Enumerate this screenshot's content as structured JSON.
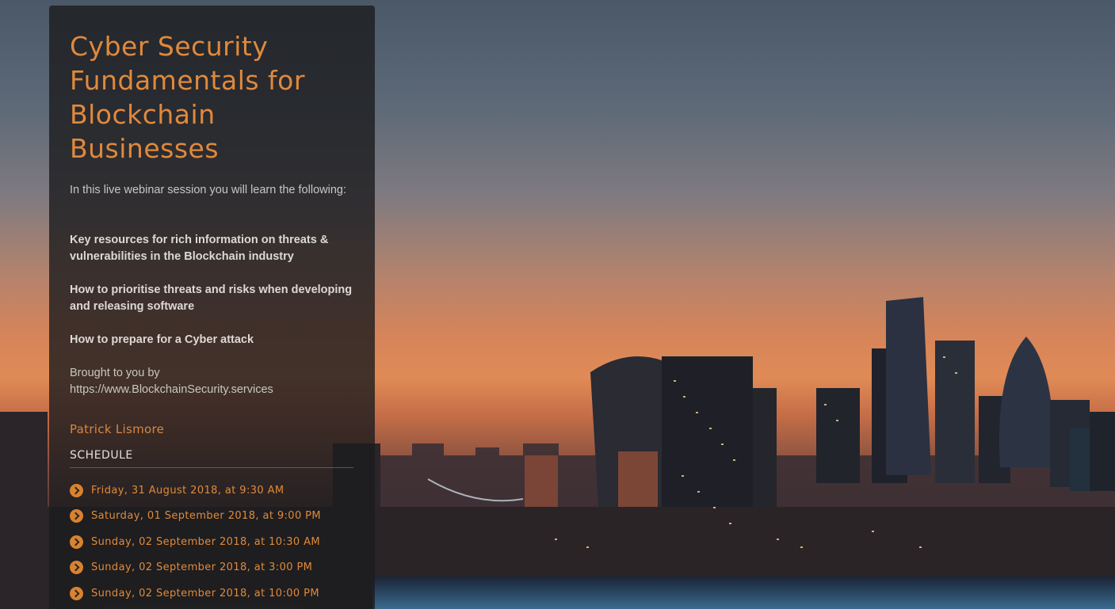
{
  "webinar": {
    "title": "Cyber Security Fundamentals for Blockchain Businesses",
    "intro": "In this live webinar session you will learn the following:",
    "points": [
      "Key resources for rich information on threats & vulnerabilities in the Blockchain industry",
      "How to prioritise threats and risks when developing and releasing software",
      "How to prepare for a Cyber attack"
    ],
    "brought_by": "Brought to you by https://www.BlockchainSecurity.services",
    "presenter": "Patrick Lismore"
  },
  "schedule": {
    "heading": "SCHEDULE",
    "sessions": [
      "Friday, 31 August 2018, at 9:30 AM",
      "Saturday, 01 September 2018, at 9:00 PM",
      "Sunday, 02 September 2018, at 10:30 AM",
      "Sunday, 02 September 2018, at 3:00 PM",
      "Sunday, 02 September 2018, at 10:00 PM"
    ]
  },
  "icons": {
    "session_bullet": "chevron-right-circle-icon"
  },
  "colors": {
    "accent": "#e0893c",
    "panel": "#1c1c1e"
  }
}
